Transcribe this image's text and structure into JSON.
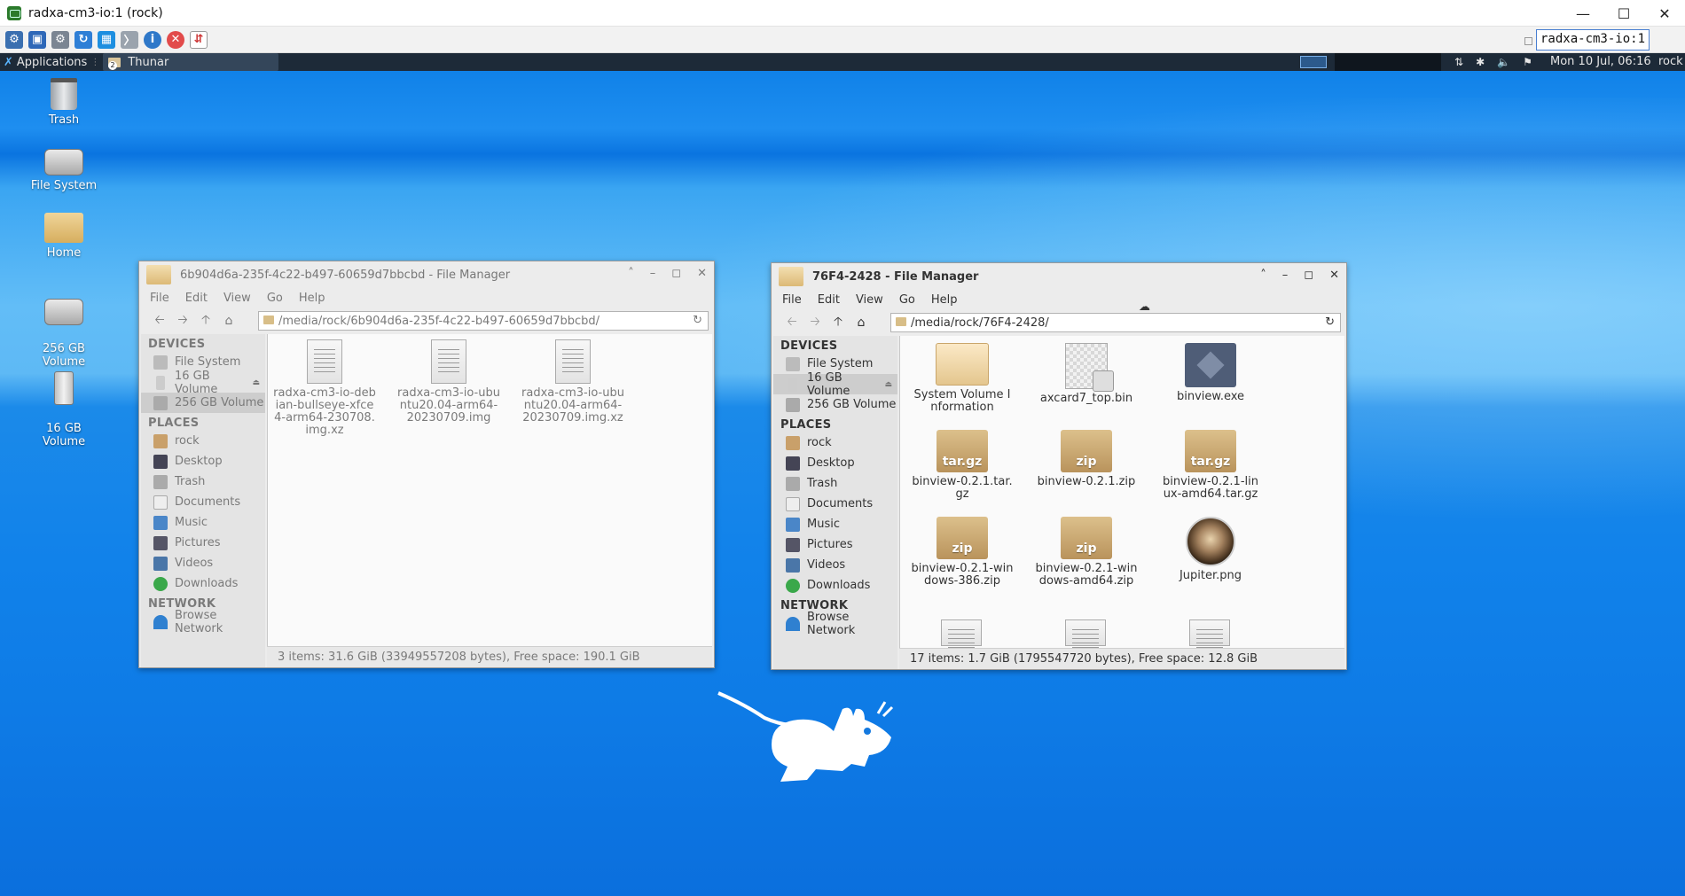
{
  "vnc": {
    "title": "radxa-cm3-io:1 (rock)",
    "field_value": "radxa-cm3-io:1",
    "toolbar_icons": [
      "options-icon",
      "fullscreen-icon",
      "settings-icon",
      "refresh-icon",
      "windows-key-icon",
      "ctrl-alt-del-icon",
      "info-icon",
      "disconnect-icon",
      "transfer-icon"
    ],
    "window_buttons": [
      "minimize",
      "maximize",
      "close"
    ]
  },
  "panel": {
    "applications_label": "Applications",
    "task_label": "Thunar",
    "task_count": "2",
    "clock": "Mon 10 Jul, 06:16",
    "user": "rock"
  },
  "desktop_icons": [
    {
      "label": "Trash"
    },
    {
      "label": "File System"
    },
    {
      "label": "Home"
    },
    {
      "label": "256 GB\nVolume"
    },
    {
      "label": "16 GB\nVolume"
    }
  ],
  "fm1": {
    "title": "6b904d6a-235f-4c22-b497-60659d7bbcbd - File Manager",
    "menu": [
      "File",
      "Edit",
      "View",
      "Go",
      "Help"
    ],
    "location": "/media/rock/6b904d6a-235f-4c22-b497-60659d7bbcbd/",
    "files": [
      {
        "name": "radxa-cm3-io-debian-bullseye-xfce4-arm64-230708.img.xz"
      },
      {
        "name": "radxa-cm3-io-ubuntu20.04-arm64-20230709.img"
      },
      {
        "name": "radxa-cm3-io-ubuntu20.04-arm64-20230709.img.xz"
      }
    ],
    "status": "3 items: 31.6 GiB (33949557208 bytes), Free space: 190.1 GiB"
  },
  "fm2": {
    "title": "76F4-2428 - File Manager",
    "menu": [
      "File",
      "Edit",
      "View",
      "Go",
      "Help"
    ],
    "location": "/media/rock/76F4-2428/",
    "files": [
      {
        "name": "System Volume Information",
        "kind": "folder"
      },
      {
        "name": "axcard7_top.bin",
        "kind": "bin"
      },
      {
        "name": "binview.exe",
        "kind": "exe"
      },
      {
        "name": "binview-0.2.1.tar.gz",
        "kind": "box",
        "badge": "tar.gz"
      },
      {
        "name": "binview-0.2.1.zip",
        "kind": "box",
        "badge": "zip"
      },
      {
        "name": "binview-0.2.1-linux-amd64.tar.gz",
        "kind": "box",
        "badge": "tar.gz"
      },
      {
        "name": "binview-0.2.1-windows-386.zip",
        "kind": "box",
        "badge": "zip"
      },
      {
        "name": "binview-0.2.1-windows-amd64.zip",
        "kind": "box",
        "badge": "zip"
      },
      {
        "name": "Jupiter.png",
        "kind": "png"
      }
    ],
    "status": "17 items: 1.7 GiB (1795547720 bytes), Free space: 12.8 GiB"
  },
  "sidebar": {
    "devices_header": "DEVICES",
    "devices": [
      "File System",
      "16 GB Volume",
      "256 GB Volume"
    ],
    "places_header": "PLACES",
    "places": [
      "rock",
      "Desktop",
      "Trash",
      "Documents",
      "Music",
      "Pictures",
      "Videos",
      "Downloads"
    ],
    "network_header": "NETWORK",
    "network": [
      "Browse Network"
    ]
  }
}
